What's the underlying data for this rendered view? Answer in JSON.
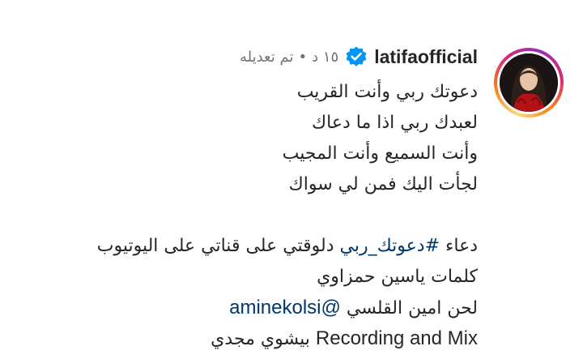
{
  "post": {
    "username": "latifaofficial",
    "verified": true,
    "time_ago": "١٥ د",
    "separator": "•",
    "edited_label": "تم تعديله",
    "colors": {
      "link": "#00376b",
      "verified_badge": "#0095f6",
      "meta": "#737373",
      "text": "#262626"
    }
  },
  "caption": {
    "line1": "دعوتك ربي وأنت القريب",
    "line2": "لعبدك ربي اذا ما دعاك",
    "line3": "وأنت السميع وأنت المجيب",
    "line4": "لجأت اليك فمن لي سواك",
    "credit1_prefix": "دعاء ",
    "credit1_hashtag": "#دعوتك_ربي",
    "credit1_suffix": " دلوقتي على قناتي على اليوتيوب",
    "credit2": "كلمات ياسين حمزاوي",
    "credit3_prefix": "لحن امين القلسي ",
    "credit3_mention": "@aminekolsi",
    "credit4_latin": "Recording and Mix",
    "credit4_arabic": "بيشوي مجدي"
  },
  "icons": {
    "verified": "verified-check-icon"
  }
}
